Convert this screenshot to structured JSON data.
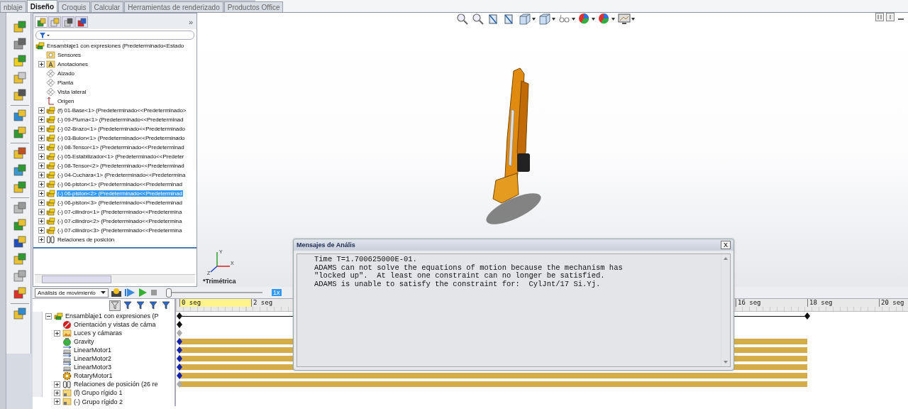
{
  "tabs": [
    {
      "label": "nblaje",
      "selected": false
    },
    {
      "label": "Diseño",
      "selected": true
    },
    {
      "label": "Croquis",
      "selected": false
    },
    {
      "label": "Calcular",
      "selected": false
    },
    {
      "label": "Herramientas de renderizado",
      "selected": false
    },
    {
      "label": "Productos Office",
      "selected": false
    }
  ],
  "feature_tree": {
    "panel_tabs": [
      {
        "selected": true
      },
      {
        "selected": false
      },
      {
        "selected": false
      },
      {
        "selected": false
      }
    ],
    "more": "»",
    "root": {
      "label": "Ensamblaje1 con expresiones  (Predeterminado<Estado",
      "kind": "assembly",
      "children": [
        {
          "label": "Sensores",
          "kind": "sensor",
          "collapsed": false,
          "selected": false
        },
        {
          "label": "Anotaciones",
          "kind": "annotation",
          "collapsed": true,
          "selected": false
        },
        {
          "label": "Alzado",
          "kind": "plane",
          "collapsed": false,
          "selected": false
        },
        {
          "label": "Planta",
          "kind": "plane",
          "collapsed": false,
          "selected": false
        },
        {
          "label": "Vista lateral",
          "kind": "plane",
          "collapsed": false,
          "selected": false
        },
        {
          "label": "Origen",
          "kind": "origin",
          "collapsed": false,
          "selected": false
        },
        {
          "label": "(f) 01-Base<1> (Predeterminado<<Predeterminado>",
          "kind": "part",
          "collapsed": true,
          "selected": false
        },
        {
          "label": "(-) 09-Pluma<1> (Predeterminado<<Predeterminad",
          "kind": "part",
          "collapsed": true,
          "selected": false
        },
        {
          "label": "(-) 02-Brazo<1> (Predeterminado<<Predeterminado",
          "kind": "part",
          "collapsed": true,
          "selected": false
        },
        {
          "label": "(-) 03-Bulon<1> (Predeterminado<<Predeterminado",
          "kind": "part",
          "collapsed": true,
          "selected": false
        },
        {
          "label": "(-) 08-Tensor<1> (Predeterminado<<Predeterminad",
          "kind": "part",
          "collapsed": true,
          "selected": false
        },
        {
          "label": "(-) 05-Estabilizador<1> (Predeterminado<<Predeter",
          "kind": "part",
          "collapsed": true,
          "selected": false
        },
        {
          "label": "(-) 08-Tensor<2> (Predeterminado<<Predeterminad",
          "kind": "part",
          "collapsed": true,
          "selected": false
        },
        {
          "label": "(-) 04-Cuchara<1> (Predeterminado<<Predetermina",
          "kind": "part",
          "collapsed": true,
          "selected": false
        },
        {
          "label": "(-) 06-piston<1> (Predeterminado<<Predeterminad",
          "kind": "part",
          "collapsed": true,
          "selected": false
        },
        {
          "label": "(-) 06-piston<2> (Predeterminado<<Predeterminad",
          "kind": "part",
          "collapsed": true,
          "selected": true
        },
        {
          "label": "(-) 06-piston<3> (Predeterminado<<Predeterminad",
          "kind": "part",
          "collapsed": true,
          "selected": false
        },
        {
          "label": "(-) 07-cilindro<1> (Predeterminado<<Predetermina",
          "kind": "part",
          "collapsed": true,
          "selected": false
        },
        {
          "label": "(-) 07-cilindro<2> (Predeterminado<<Predetermina",
          "kind": "part",
          "collapsed": true,
          "selected": false
        },
        {
          "label": "(-) 07-cilindro<3> (Predeterminado<<Predetermina",
          "kind": "part",
          "collapsed": true,
          "selected": false
        },
        {
          "label": "Relaciones de posición",
          "kind": "mates",
          "collapsed": true,
          "selected": false
        }
      ]
    }
  },
  "viewport": {
    "view_label": "*Trimétrica",
    "triad": [
      "Y",
      "X",
      "Z"
    ]
  },
  "motion_toolbar": {
    "study_type": "Análisis de movimiento",
    "slider": {
      "level": 0
    },
    "speed": "1x"
  },
  "motion_tree": {
    "root": {
      "label": "Ensamblaje1 con expresiones  (P",
      "kind": "assembly",
      "collapsed": false,
      "track": {
        "kind": "line"
      },
      "children": [
        {
          "label": "Orientación y vistas de cáma",
          "kind": "camera",
          "collapsed": false,
          "track": {
            "kind": "key"
          }
        },
        {
          "label": "Luces y cámaras",
          "kind": "lights",
          "collapsed": true,
          "track": {
            "kind": "inactive-key"
          }
        },
        {
          "label": "Gravity",
          "kind": "gravity",
          "collapsed": false,
          "track": {
            "kind": "bar"
          }
        },
        {
          "label": "LinearMotor1",
          "kind": "linear-motor",
          "collapsed": false,
          "track": {
            "kind": "bar"
          }
        },
        {
          "label": "LinearMotor2",
          "kind": "linear-motor",
          "collapsed": false,
          "track": {
            "kind": "bar"
          }
        },
        {
          "label": "LinearMotor3",
          "kind": "linear-motor",
          "collapsed": false,
          "track": {
            "kind": "bar"
          }
        },
        {
          "label": "RotaryMotor1",
          "kind": "rotary-motor",
          "collapsed": false,
          "track": {
            "kind": "bar"
          }
        },
        {
          "label": "Relaciones de posición (26 re",
          "kind": "mates",
          "collapsed": true,
          "track": {
            "kind": "inactive-bar"
          }
        },
        {
          "label": "(f) Grupo rígido 1",
          "kind": "rigid-group",
          "collapsed": true,
          "track": {
            "kind": "none"
          }
        },
        {
          "label": "(-) Grupo rígido 2",
          "kind": "rigid-group",
          "collapsed": true,
          "track": {
            "kind": "none"
          }
        }
      ]
    }
  },
  "timeline": {
    "ruler_start": [
      "0 seg",
      "2 seg"
    ],
    "ruler_end": [
      "16 seg",
      "18 seg",
      "20 seg"
    ]
  },
  "dialog": {
    "title": "Mensajes de Anális",
    "close": "X",
    "message": [
      "Time T=1.700625000E-01.",
      "ADAMS can not solve the equations of motion because the mechanism has",
      "\"locked up\".  At least one constraint can no longer be satisfied.",
      "ADAMS is unable to satisfy the constraint for:  CylJnt/17 Si.Yj."
    ]
  }
}
